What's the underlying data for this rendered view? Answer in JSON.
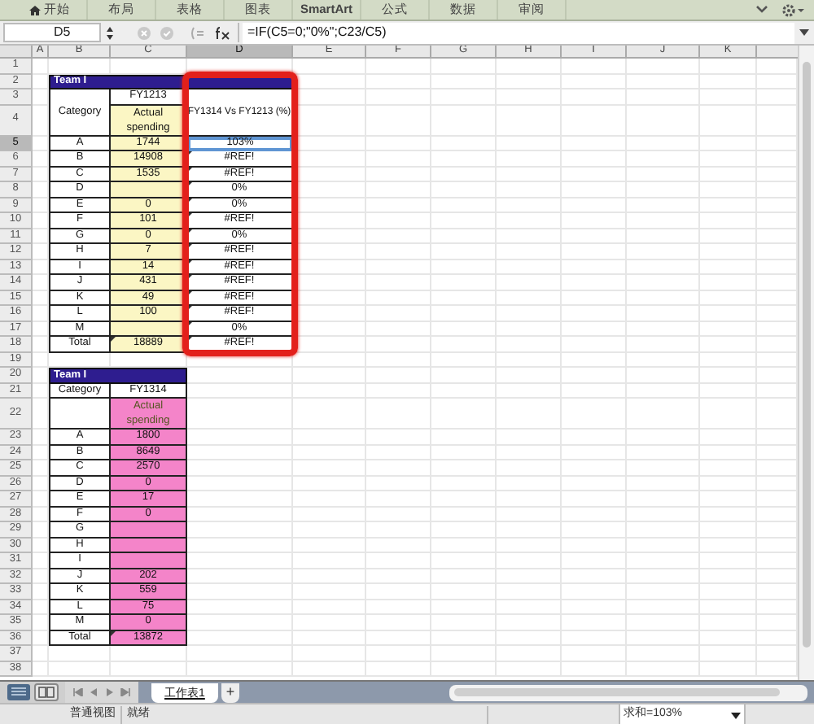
{
  "ribbon_tabs": [
    {
      "label": "开始",
      "kind": "home"
    },
    {
      "label": "布局",
      "kind": "plain"
    },
    {
      "label": "表格",
      "kind": "plain"
    },
    {
      "label": "图表",
      "kind": "plain"
    },
    {
      "label": "SmartArt",
      "kind": "plain"
    },
    {
      "label": "公式",
      "kind": "plain"
    },
    {
      "label": "数据",
      "kind": "plain"
    },
    {
      "label": "审阅",
      "kind": "plain"
    }
  ],
  "formula_bar": {
    "name_box": "D5",
    "formula": "=IF(C5=0;\"0%\";C23/C5)"
  },
  "columns": [
    {
      "label": "A",
      "selected": false
    },
    {
      "label": "B",
      "selected": false
    },
    {
      "label": "C",
      "selected": false
    },
    {
      "label": "D",
      "selected": true
    },
    {
      "label": "E",
      "selected": false
    },
    {
      "label": "F",
      "selected": false
    },
    {
      "label": "G",
      "selected": false
    },
    {
      "label": "H",
      "selected": false
    },
    {
      "label": "I",
      "selected": false
    },
    {
      "label": "J",
      "selected": false
    },
    {
      "label": "K",
      "selected": false
    }
  ],
  "row_headers": [
    {
      "label": "1",
      "selected": false
    },
    {
      "label": "2",
      "selected": false
    },
    {
      "label": "3",
      "selected": false
    },
    {
      "label": "4",
      "selected": false
    },
    {
      "label": "5",
      "selected": true
    },
    {
      "label": "6",
      "selected": false
    },
    {
      "label": "7",
      "selected": false
    },
    {
      "label": "8",
      "selected": false
    },
    {
      "label": "9",
      "selected": false
    },
    {
      "label": "10",
      "selected": false
    },
    {
      "label": "11",
      "selected": false
    },
    {
      "label": "12",
      "selected": false
    },
    {
      "label": "13",
      "selected": false
    },
    {
      "label": "14",
      "selected": false
    },
    {
      "label": "15",
      "selected": false
    },
    {
      "label": "16",
      "selected": false
    },
    {
      "label": "17",
      "selected": false
    },
    {
      "label": "18",
      "selected": false
    },
    {
      "label": "19",
      "selected": false
    },
    {
      "label": "20",
      "selected": false
    },
    {
      "label": "21",
      "selected": false
    },
    {
      "label": "22",
      "selected": false
    },
    {
      "label": "23",
      "selected": false
    },
    {
      "label": "24",
      "selected": false
    },
    {
      "label": "25",
      "selected": false
    },
    {
      "label": "26",
      "selected": false
    },
    {
      "label": "27",
      "selected": false
    },
    {
      "label": "28",
      "selected": false
    },
    {
      "label": "29",
      "selected": false
    },
    {
      "label": "30",
      "selected": false
    },
    {
      "label": "31",
      "selected": false
    },
    {
      "label": "32",
      "selected": false
    },
    {
      "label": "33",
      "selected": false
    },
    {
      "label": "34",
      "selected": false
    },
    {
      "label": "35",
      "selected": false
    },
    {
      "label": "36",
      "selected": false
    },
    {
      "label": "37",
      "selected": false
    },
    {
      "label": "38",
      "selected": false
    }
  ],
  "table_1": {
    "title": "Team I",
    "category_header": "Category",
    "year": "FY1213",
    "measure": "Actual spending",
    "ratio_header": "FY1314 Vs FY1213 (%)",
    "rows": [
      {
        "category": "A",
        "value": "1744",
        "ratio": "103%",
        "flag": false,
        "selected": true
      },
      {
        "category": "B",
        "value": "14908",
        "ratio": "#REF!",
        "flag": true,
        "selected": false
      },
      {
        "category": "C",
        "value": "1535",
        "ratio": "#REF!",
        "flag": true,
        "selected": false
      },
      {
        "category": "D",
        "ratio": "0%",
        "flag": true,
        "selected": false
      },
      {
        "category": "E",
        "value": "0",
        "ratio": "0%",
        "flag": true,
        "selected": false
      },
      {
        "category": "F",
        "value": "101",
        "ratio": "#REF!",
        "flag": true,
        "selected": false
      },
      {
        "category": "G",
        "value": "0",
        "ratio": "0%",
        "flag": true,
        "selected": false
      },
      {
        "category": "H",
        "value": "7",
        "ratio": "#REF!",
        "flag": true,
        "selected": false
      },
      {
        "category": "I",
        "value": "14",
        "ratio": "#REF!",
        "flag": true,
        "selected": false
      },
      {
        "category": "J",
        "value": "431",
        "ratio": "#REF!",
        "flag": true,
        "selected": false
      },
      {
        "category": "K",
        "value": "49",
        "ratio": "#REF!",
        "flag": true,
        "selected": false
      },
      {
        "category": "L",
        "value": "100",
        "ratio": "#REF!",
        "flag": true,
        "selected": false
      },
      {
        "category": "M",
        "ratio": "0%",
        "flag": true,
        "selected": false
      }
    ],
    "total": {
      "label": "Total",
      "value": "18889",
      "ratio": "#REF!",
      "flag": true
    }
  },
  "table_2": {
    "title": "Team I",
    "category_header": "Category",
    "year": "FY1314",
    "measure": "Actual spending",
    "rows": [
      {
        "category": "A",
        "value": "1800"
      },
      {
        "category": "B",
        "value": "8649"
      },
      {
        "category": "C",
        "value": "2570"
      },
      {
        "category": "D",
        "value": "0"
      },
      {
        "category": "E",
        "value": "17"
      },
      {
        "category": "F",
        "value": "0"
      },
      {
        "category": "G"
      },
      {
        "category": "H"
      },
      {
        "category": "I"
      },
      {
        "category": "J",
        "value": "202"
      },
      {
        "category": "K",
        "value": "559"
      },
      {
        "category": "L",
        "value": "75"
      },
      {
        "category": "M",
        "value": "0"
      }
    ],
    "total": {
      "label": "Total",
      "value": "13872",
      "flag": true
    }
  },
  "sheet_tabs": [
    {
      "label": "工作表1",
      "selected": true
    }
  ],
  "add_sheet": "+",
  "status_bar": {
    "view_mode": "普通视图",
    "state": "就绪",
    "sum": "求和=103%"
  }
}
